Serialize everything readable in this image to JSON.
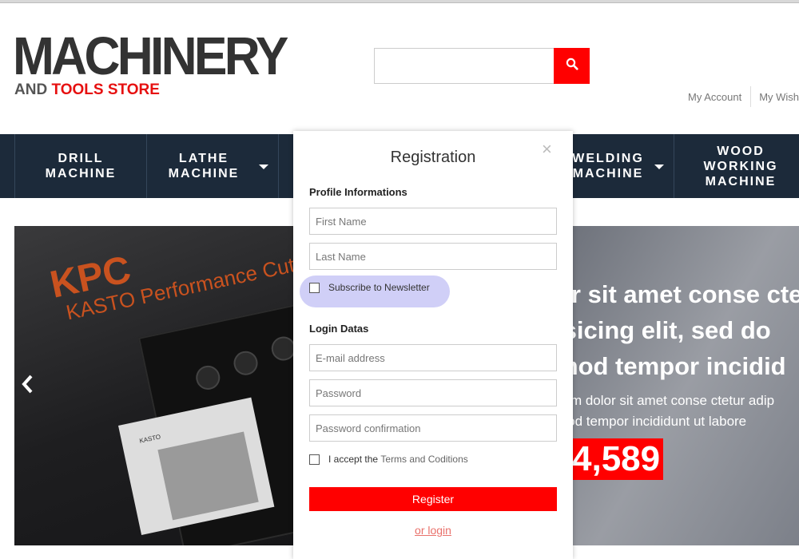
{
  "header": {
    "logo_main": "MACHINERY",
    "logo_sub_a": "AND",
    "logo_sub_b": "TOOLS STORE",
    "search_placeholder": "",
    "links": [
      "My Account",
      "My Wishl"
    ]
  },
  "nav": {
    "items": [
      {
        "label": "DRILL MACHINE",
        "dropdown": false
      },
      {
        "label": "LATHE MACHINE",
        "dropdown": true
      },
      {
        "label": "WELDING MACHINE",
        "dropdown": true
      },
      {
        "label": "WOOD WORKING MACHINE",
        "dropdown": false
      }
    ]
  },
  "slider": {
    "image_brand": "KPC",
    "image_sub": "KASTO Performance Cutti",
    "image_small": "KASTO",
    "headline_lines": [
      "or sit amet conse cte",
      "isicing elit, sed do",
      "mod tempor incidid"
    ],
    "body_lines": [
      "sum dolor sit amet conse ctetur adip",
      "mod tempor incididunt ut labore"
    ],
    "price": "4,589",
    "prev_icon": "chevron-left-icon"
  },
  "modal": {
    "title": "Registration",
    "close_icon": "close-icon",
    "profile_section": "Profile Informations",
    "first_name_placeholder": "First Name",
    "last_name_placeholder": "Last Name",
    "subscribe_label": "Subscribe to Newsletter",
    "login_section": "Login Datas",
    "email_placeholder": "E-mail address",
    "password_placeholder": "Password",
    "password_confirm_placeholder": "Password confirmation",
    "accept_label": "I accept the",
    "terms_label": "Terms and Coditions",
    "register_label": "Register",
    "or_login_label": "or login"
  },
  "colors": {
    "accent": "#ff0000",
    "nav_bg": "#1c2a3a",
    "highlight": "#d0cff7"
  }
}
